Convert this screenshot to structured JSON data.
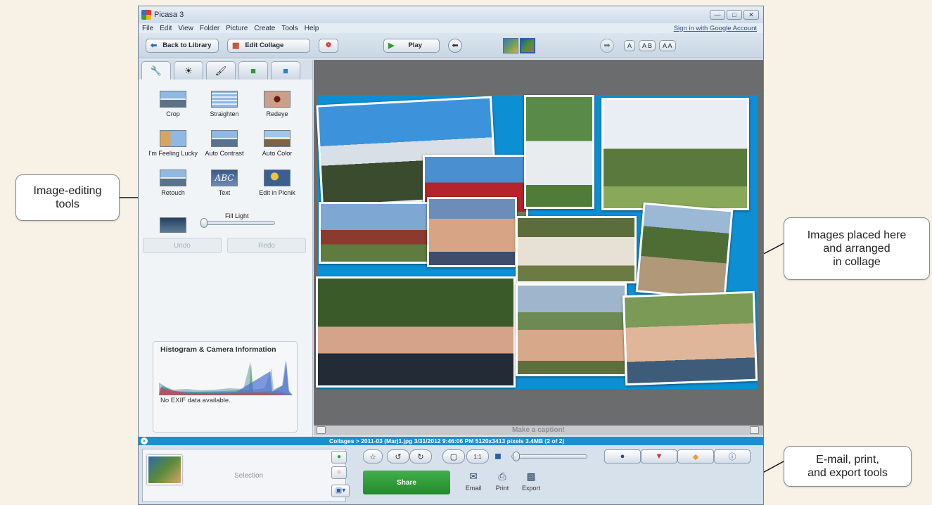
{
  "app": {
    "title": "Picasa 3"
  },
  "menu": {
    "items": [
      "File",
      "Edit",
      "View",
      "Folder",
      "Picture",
      "Create",
      "Tools",
      "Help"
    ],
    "signin": "Sign in with Google Account"
  },
  "toolbar": {
    "back_label": "Back to Library",
    "edit_collage_label": "Edit Collage",
    "play_label": "Play",
    "text_a": "A",
    "text_ab": "A B",
    "text_aa": "A A"
  },
  "tools": [
    {
      "label": "Crop"
    },
    {
      "label": "Straighten"
    },
    {
      "label": "Redeye"
    },
    {
      "label": "I'm Feeling Lucky"
    },
    {
      "label": "Auto Contrast"
    },
    {
      "label": "Auto Color"
    },
    {
      "label": "Retouch"
    },
    {
      "label": "Text"
    },
    {
      "label": "Edit in Picnik"
    }
  ],
  "text_tool_glyph": "ABC",
  "fill_light_label": "Fill Light",
  "undo_label": "Undo",
  "redo_label": "Redo",
  "histogram": {
    "title": "Histogram & Camera Information",
    "exif": "No EXIF data available."
  },
  "caption_placeholder": "Make a caption!",
  "status": {
    "text": "Collages > 2011-03 (Marj1.jpg   3/31/2012 9:46:06 PM   5120x3413 pixels   3.4MB   (2 of 2)"
  },
  "tray": {
    "selection_label": "Selection",
    "share_label": "Share",
    "email_label": "Email",
    "print_label": "Print",
    "export_label": "Export"
  },
  "callouts": {
    "image_editing": "Image-editing\ntools",
    "images_placed": "Images placed here\nand arranged\nin collage",
    "email_print": "E-mail, print,\nand export tools"
  },
  "colors": {
    "collage_background": "#0d8fd4",
    "status_bar": "#1b8fcf",
    "share_button": "#2e9e38"
  }
}
